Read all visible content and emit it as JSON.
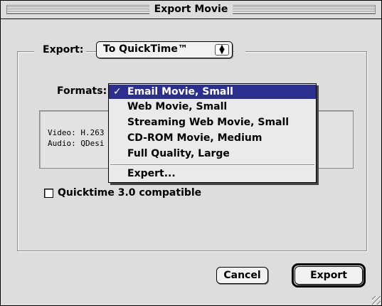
{
  "window": {
    "title": "Export Movie"
  },
  "export": {
    "label": "Export:",
    "selected": "To QuickTime™",
    "arrows_icon": "up-down-arrows-icon"
  },
  "formats": {
    "label": "Formats:",
    "menu_items": [
      {
        "label": "Email Movie, Small",
        "checked": true,
        "highlighted": true
      },
      {
        "label": "Web Movie, Small"
      },
      {
        "label": "Streaming Web Movie, Small"
      },
      {
        "label": "CD-ROM Movie, Medium"
      },
      {
        "label": "Full Quality, Large"
      },
      {
        "label": "Expert..."
      }
    ],
    "check_glyph": "✓"
  },
  "info": {
    "video": "Video: H.263",
    "audio": "Audio: QDesi"
  },
  "option": {
    "label": "Quicktime 3.0 compatible",
    "checked": false
  },
  "buttons": {
    "cancel": "Cancel",
    "export": "Export"
  },
  "colors": {
    "highlight": "#2d2f8f",
    "window_bg": "#dddddd"
  }
}
